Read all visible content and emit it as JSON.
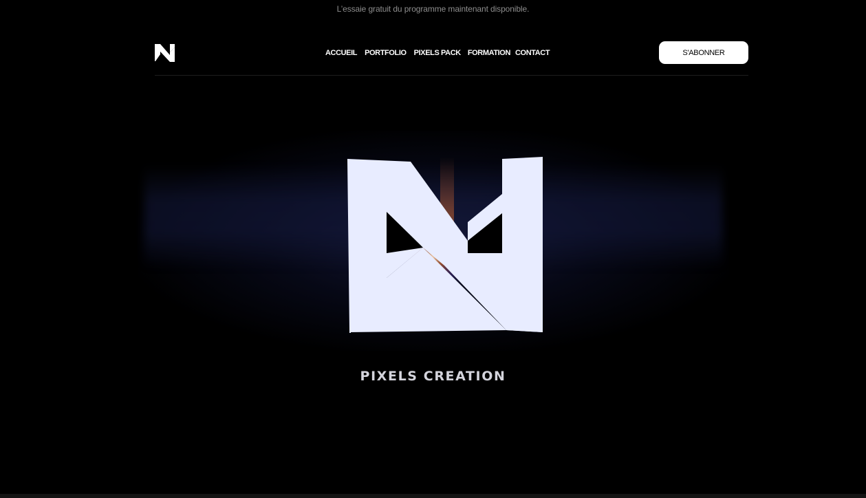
{
  "announcement": "L’essaie gratuit du programme  maintenant disponible.",
  "header": {
    "logo_icon": "pixels-n-logo-icon",
    "nav": [
      {
        "label": "ACCUEIL"
      },
      {
        "label": "PORTFOLIO"
      },
      {
        "label": "PIXELS PACK"
      },
      {
        "label": "FORMATION"
      },
      {
        "label": "CONTACT"
      }
    ],
    "subscribe_label": "S'ABONNER"
  },
  "hero": {
    "video_logo_icon": "pixels-n-logo-icon",
    "caption": "PIXELS CREATION"
  },
  "colors": {
    "background": "#000000",
    "accent_white": "#ffffff",
    "logo_tint": "#e8ecff",
    "glow_blue": "#1c2150",
    "glow_orange": "#c2602e"
  }
}
